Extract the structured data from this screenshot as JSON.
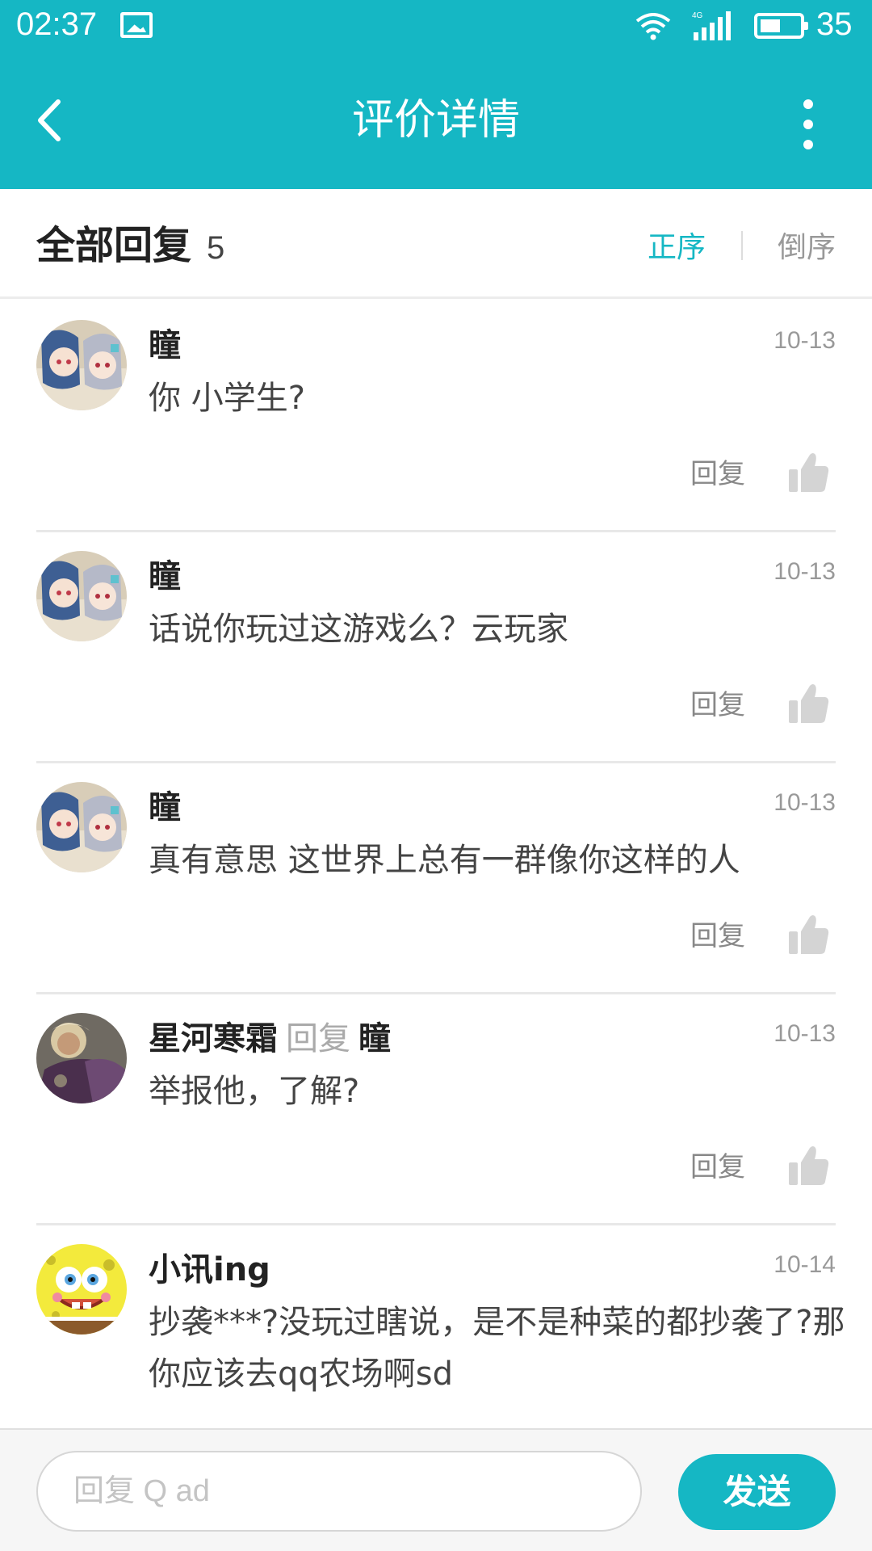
{
  "status_bar": {
    "time": "02:37",
    "battery": "35",
    "network": "4G"
  },
  "header": {
    "title": "评价详情"
  },
  "sort": {
    "title": "全部回复",
    "count": "5",
    "ascending": "正序",
    "descending": "倒序"
  },
  "comments": [
    {
      "author": "瞳",
      "reply_to_label": "",
      "reply_to": "",
      "date": "10-13",
      "text": "你 小学生?",
      "reply_label": "回复",
      "avatar": "anime-girls"
    },
    {
      "author": "瞳",
      "reply_to_label": "",
      "reply_to": "",
      "date": "10-13",
      "text": "话说你玩过这游戏么？云玩家",
      "reply_label": "回复",
      "avatar": "anime-girls"
    },
    {
      "author": "瞳",
      "reply_to_label": "",
      "reply_to": "",
      "date": "10-13",
      "text": "真有意思 这世界上总有一群像你这样的人",
      "reply_label": "回复",
      "avatar": "anime-girls"
    },
    {
      "author": "星河寒霜",
      "reply_to_label": "回复",
      "reply_to": "瞳",
      "date": "10-13",
      "text": "举报他，了解?",
      "reply_label": "回复",
      "avatar": "armored-warrior"
    },
    {
      "author": "小讯ing",
      "reply_to_label": "",
      "reply_to": "",
      "date": "10-14",
      "text": "抄袭***?没玩过瞎说，是不是种菜的都抄袭了?那你应该去qq农场啊sd",
      "reply_label": "",
      "avatar": "spongebob"
    }
  ],
  "input": {
    "value": "回复 Q ad",
    "placeholder": "回复 Q ad",
    "send_label": "发送"
  },
  "colors": {
    "accent": "#15b7c4",
    "background": "#ffffff",
    "divider": "#e8e8e8"
  }
}
